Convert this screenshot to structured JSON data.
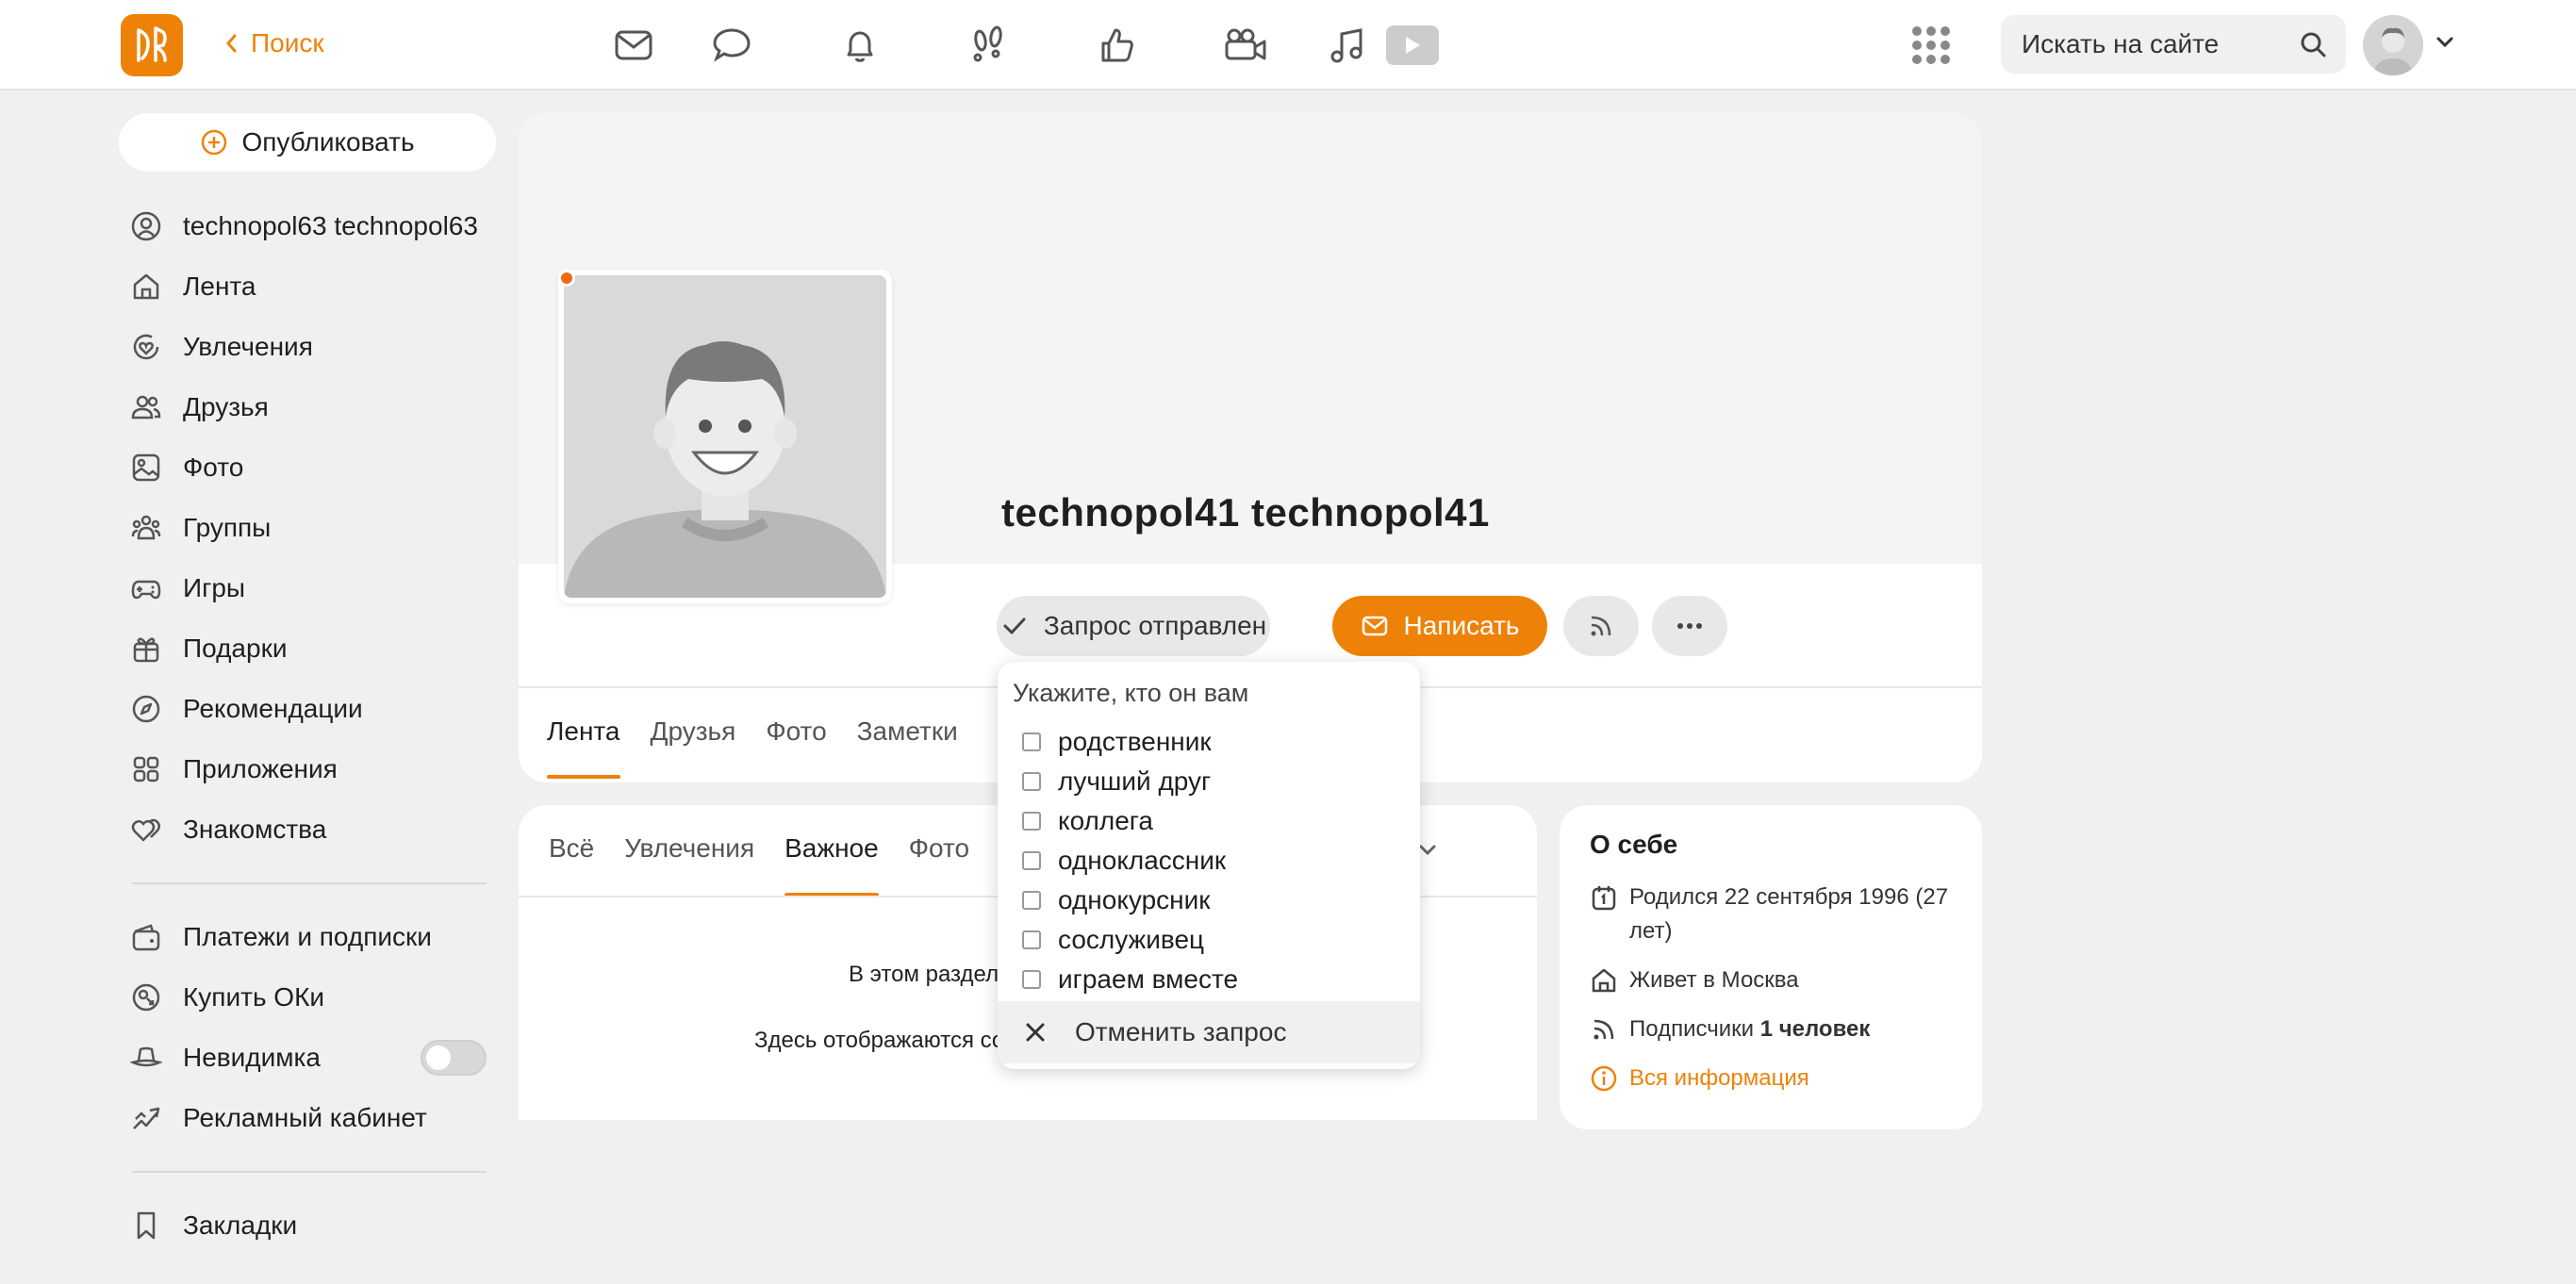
{
  "header": {
    "back_label": "Поиск",
    "search_placeholder": "Искать на сайте",
    "nav_icons": [
      "mail-icon",
      "chat-icon",
      "bell-icon",
      "footprints-icon",
      "thumbs-up-icon",
      "video-camera-icon",
      "music-icon",
      "video-play-icon"
    ]
  },
  "sidebar": {
    "publish_label": "Опубликовать",
    "items": [
      {
        "label": "technopol63 technopol63",
        "icon": "profile-icon"
      },
      {
        "label": "Лента",
        "icon": "home-icon"
      },
      {
        "label": "Увлечения",
        "icon": "hobbies-icon"
      },
      {
        "label": "Друзья",
        "icon": "friends-icon"
      },
      {
        "label": "Фото",
        "icon": "photo-icon"
      },
      {
        "label": "Группы",
        "icon": "groups-icon"
      },
      {
        "label": "Игры",
        "icon": "gamepad-icon"
      },
      {
        "label": "Подарки",
        "icon": "gift-icon"
      },
      {
        "label": "Рекомендации",
        "icon": "compass-icon"
      },
      {
        "label": "Приложения",
        "icon": "apps-icon"
      },
      {
        "label": "Знакомства",
        "icon": "hearts-icon"
      }
    ],
    "items2": [
      {
        "label": "Платежи и подписки",
        "icon": "wallet-icon"
      },
      {
        "label": "Купить ОКи",
        "icon": "coins-icon"
      },
      {
        "label": "Невидимка",
        "icon": "incognito-hat-icon",
        "toggle": false
      },
      {
        "label": "Рекламный кабинет",
        "icon": "chart-up-icon"
      }
    ],
    "items3": [
      {
        "label": "Закладки",
        "icon": "bookmark-icon"
      }
    ]
  },
  "profile": {
    "name": "technopol41 technopol41",
    "request_sent_label": "Запрос отправлен",
    "write_label": "Написать",
    "tabs": [
      "Лента",
      "Друзья",
      "Фото",
      "Заметки"
    ],
    "active_tab": "Лента"
  },
  "relation_menu": {
    "heading": "Укажите, кто он вам",
    "options": [
      "родственник",
      "лучший друг",
      "коллега",
      "одноклассник",
      "однокурсник",
      "сослуживец",
      "играем вместе"
    ],
    "cancel_label": "Отменить запрос"
  },
  "feed": {
    "tabs": [
      "Всё",
      "Увлечения",
      "Важное",
      "Фото"
    ],
    "active_tab": "Важное",
    "empty_line1": "В этом раздел",
    "empty_line2": "Здесь отображаются со"
  },
  "about": {
    "title": "О себе",
    "born": "Родился 22 сентября 1996 (27 лет)",
    "lives": "Живет в Москва",
    "subscribers_prefix": "Подписчики ",
    "subscribers_count": "1 человек",
    "all_info": "Вся информация"
  },
  "colors": {
    "accent": "#ee8208",
    "background": "#f0f0f0"
  }
}
